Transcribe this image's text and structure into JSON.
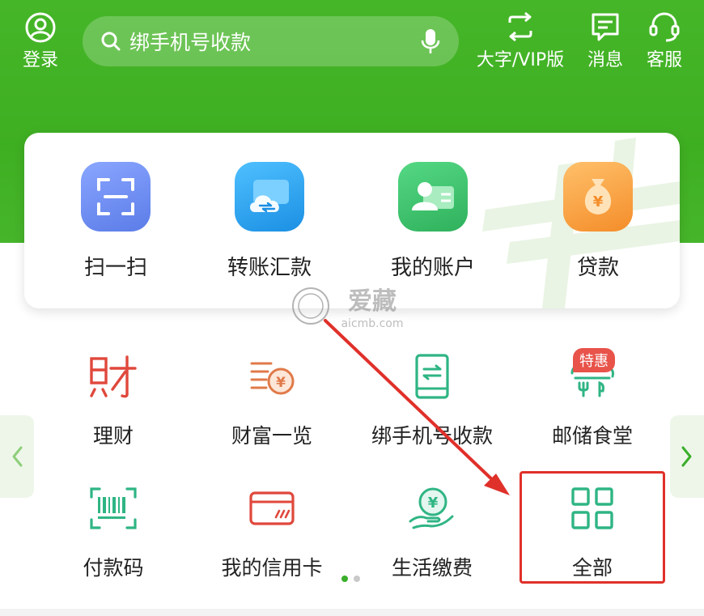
{
  "header": {
    "login_label": "登录",
    "search_placeholder": "绑手机号收款",
    "bigfont_label": "大字/VIP版",
    "messages_label": "消息",
    "service_label": "客服"
  },
  "quick_actions": [
    {
      "label": "扫一扫",
      "icon": "scan-icon",
      "color": "#6a8cf0"
    },
    {
      "label": "转账汇款",
      "icon": "transfer-cloud-icon",
      "color": "#2fa6ef"
    },
    {
      "label": "我的账户",
      "icon": "account-card-icon",
      "color": "#39c16a"
    },
    {
      "label": "贷款",
      "icon": "money-bag-icon",
      "color": "#f7a13a"
    }
  ],
  "grid": [
    {
      "label": "理财",
      "icon": "wealth-char-icon"
    },
    {
      "label": "财富一览",
      "icon": "coins-icon"
    },
    {
      "label": "绑手机号收款",
      "icon": "phone-transfer-icon"
    },
    {
      "label": "邮储食堂",
      "icon": "canteen-icon",
      "badge": "特惠"
    },
    {
      "label": "付款码",
      "icon": "barcode-icon"
    },
    {
      "label": "我的信用卡",
      "icon": "credit-card-icon"
    },
    {
      "label": "生活缴费",
      "icon": "bill-pay-icon"
    },
    {
      "label": "全部",
      "icon": "grid-all-icon"
    }
  ],
  "watermark": {
    "text": "爱藏",
    "domain": "aicmb.com"
  },
  "pager": {
    "current": 1,
    "total": 2
  },
  "colors": {
    "brand_green": "#3faf22",
    "icon_red": "#e0483c",
    "icon_green": "#2fb584",
    "annotation_red": "#e0302a"
  }
}
